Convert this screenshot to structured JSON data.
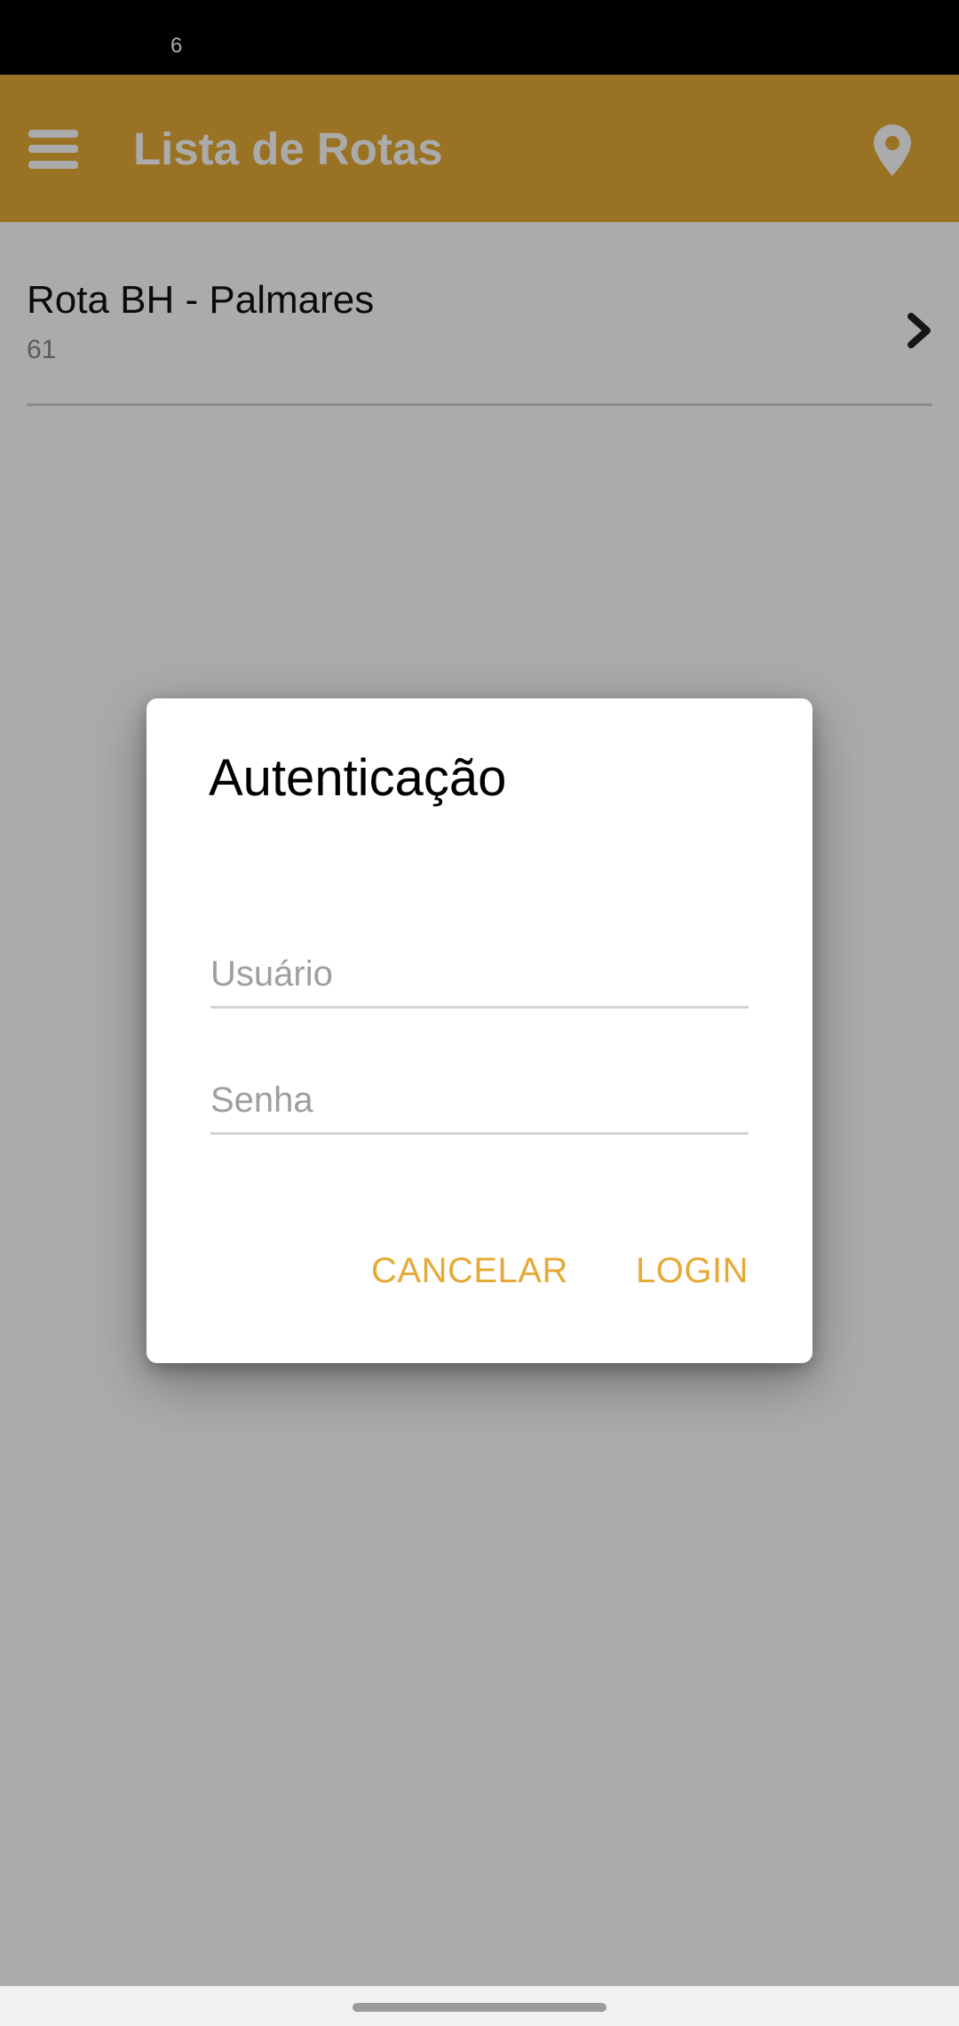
{
  "status_bar": {
    "time": "6"
  },
  "app_bar": {
    "title": "Lista de Rotas",
    "menu_icon": "hamburger-menu-icon",
    "location_icon": "map-pin-icon",
    "color": "#E5AA36"
  },
  "routes": [
    {
      "name": "Rota BH - Palmares",
      "number": "61",
      "chevron_icon": "chevron-right-icon"
    }
  ],
  "dialog": {
    "title": "Autenticação",
    "username_placeholder": "Usuário",
    "password_placeholder": "Senha",
    "cancel_label": "CANCELAR",
    "login_label": "LOGIN",
    "accent_color": "#E5AA36"
  }
}
